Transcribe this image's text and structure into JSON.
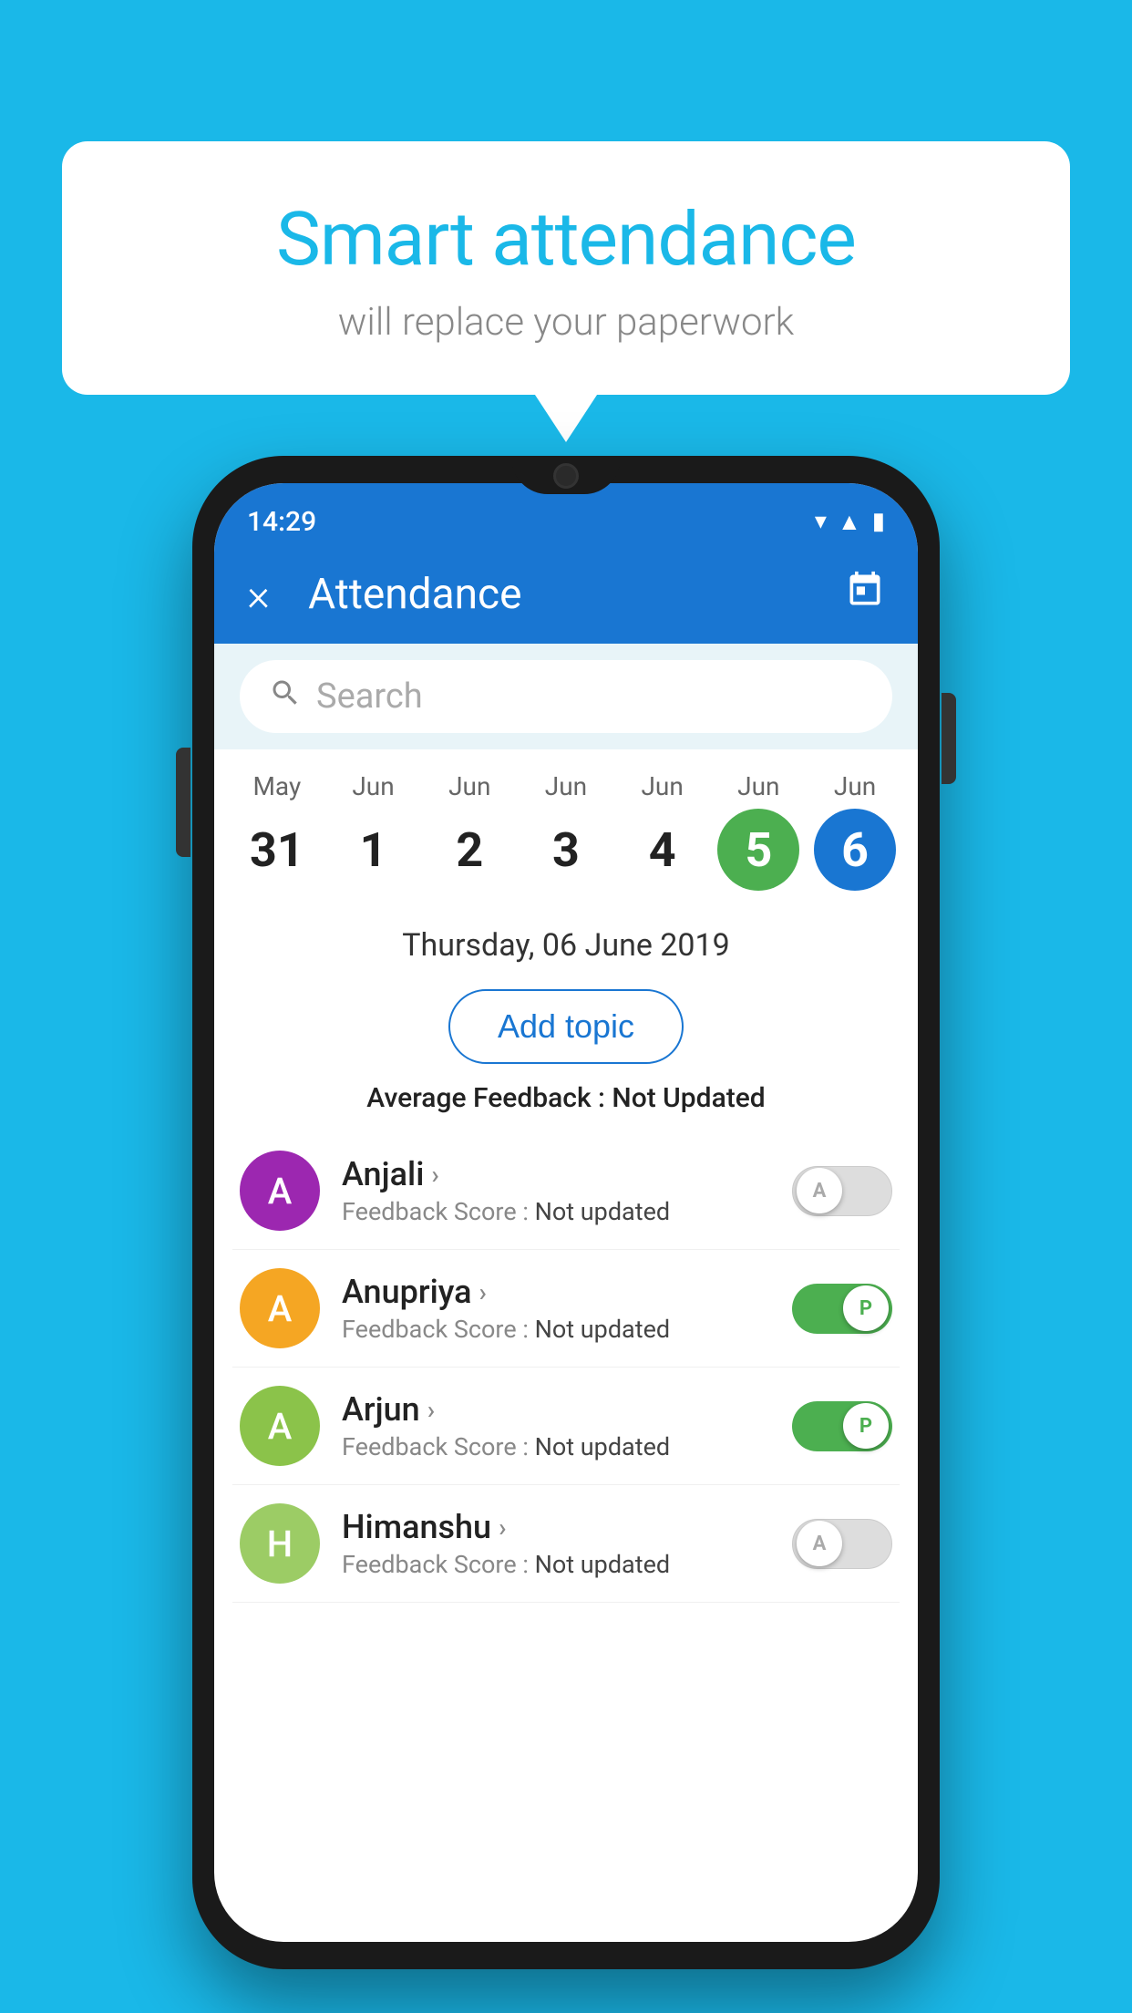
{
  "background_color": "#1ab8e8",
  "speech_bubble": {
    "title": "Smart attendance",
    "subtitle": "will replace your paperwork"
  },
  "status_bar": {
    "time": "14:29",
    "wifi": "▾",
    "signal": "▲",
    "battery": "▮"
  },
  "app_bar": {
    "title": "Attendance",
    "close_label": "×",
    "calendar_label": "📅"
  },
  "search": {
    "placeholder": "Search"
  },
  "calendar": {
    "days": [
      {
        "month": "May",
        "date": "31",
        "state": "normal"
      },
      {
        "month": "Jun",
        "date": "1",
        "state": "normal"
      },
      {
        "month": "Jun",
        "date": "2",
        "state": "normal"
      },
      {
        "month": "Jun",
        "date": "3",
        "state": "normal"
      },
      {
        "month": "Jun",
        "date": "4",
        "state": "normal"
      },
      {
        "month": "Jun",
        "date": "5",
        "state": "today"
      },
      {
        "month": "Jun",
        "date": "6",
        "state": "selected"
      }
    ]
  },
  "selected_date": "Thursday, 06 June 2019",
  "add_topic_label": "Add topic",
  "avg_feedback_label": "Average Feedback :",
  "avg_feedback_value": "Not Updated",
  "students": [
    {
      "name": "Anjali",
      "initial": "A",
      "avatar_color": "#9c27b0",
      "feedback_label": "Feedback Score :",
      "feedback_value": "Not updated",
      "toggle_state": "off",
      "toggle_label": "A"
    },
    {
      "name": "Anupriya",
      "initial": "A",
      "avatar_color": "#f5a623",
      "feedback_label": "Feedback Score :",
      "feedback_value": "Not updated",
      "toggle_state": "on",
      "toggle_label": "P"
    },
    {
      "name": "Arjun",
      "initial": "A",
      "avatar_color": "#8bc34a",
      "feedback_label": "Feedback Score :",
      "feedback_value": "Not updated",
      "toggle_state": "on",
      "toggle_label": "P"
    },
    {
      "name": "Himanshu",
      "initial": "H",
      "avatar_color": "#9ccc65",
      "feedback_label": "Feedback Score :",
      "feedback_value": "Not updated",
      "toggle_state": "off",
      "toggle_label": "A"
    }
  ]
}
